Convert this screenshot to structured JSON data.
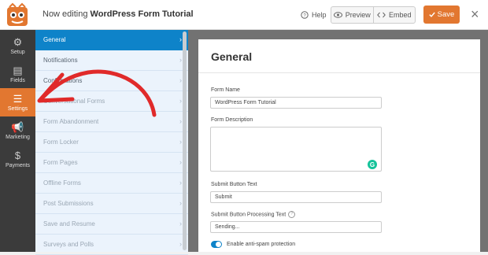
{
  "header": {
    "editing_prefix": "Now editing",
    "form_title": "WordPress Form Tutorial",
    "help_label": "Help",
    "preview_label": "Preview",
    "embed_label": "Embed",
    "save_label": "Save",
    "close_glyph": "×"
  },
  "leftnav": {
    "items": [
      {
        "label": "Setup",
        "icon": "gear-icon",
        "glyph": "⚙"
      },
      {
        "label": "Fields",
        "icon": "fields-icon",
        "glyph": "▤"
      },
      {
        "label": "Settings",
        "icon": "sliders-icon",
        "glyph": "☰"
      },
      {
        "label": "Marketing",
        "icon": "megaphone-icon",
        "glyph": "📢"
      },
      {
        "label": "Payments",
        "icon": "dollar-icon",
        "glyph": "$"
      }
    ],
    "active": "Settings"
  },
  "subnav": {
    "items": [
      {
        "label": "General"
      },
      {
        "label": "Notifications"
      },
      {
        "label": "Confirmations"
      },
      {
        "label": "Conversational Forms"
      },
      {
        "label": "Form Abandonment"
      },
      {
        "label": "Form Locker"
      },
      {
        "label": "Form Pages"
      },
      {
        "label": "Offline Forms"
      },
      {
        "label": "Post Submissions"
      },
      {
        "label": "Save and Resume"
      },
      {
        "label": "Surveys and Polls"
      }
    ],
    "chevron": "›",
    "active": "General"
  },
  "panel": {
    "title": "General",
    "form_name_label": "Form Name",
    "form_name_value": "WordPress Form Tutorial",
    "form_description_label": "Form Description",
    "form_description_value": "",
    "submit_text_label": "Submit Button Text",
    "submit_text_value": "Submit",
    "processing_text_label": "Submit Button Processing Text",
    "processing_text_value": "Sending...",
    "antispam_label": "Enable anti-spam protection",
    "antispam_enabled": true,
    "help_glyph": "?"
  },
  "colors": {
    "accent_orange": "#e27730",
    "active_blue": "#0e83c9",
    "nav_dark": "#3b3b3b",
    "subnav_bg": "#ebf3fc",
    "arrow_red": "#e02a2a"
  }
}
